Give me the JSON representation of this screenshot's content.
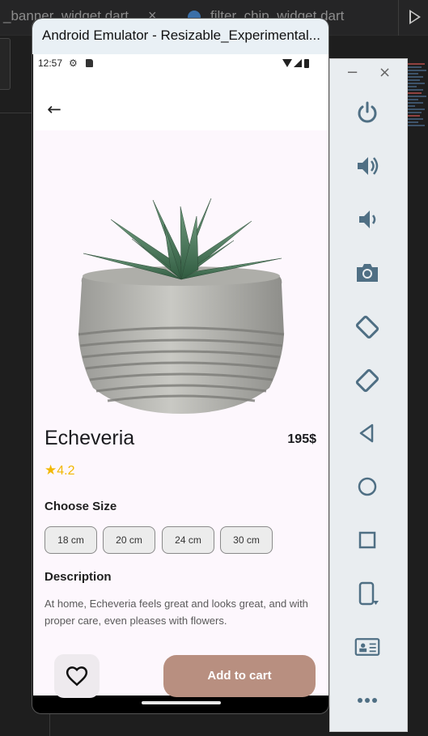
{
  "ide": {
    "tab1": "_banner_widget.dart",
    "tab1_close": "×",
    "tab2": "filter_chip_widget.dart"
  },
  "emulator": {
    "title": "Android Emulator - Resizable_Experimental..."
  },
  "status_bar": {
    "time": "12:57"
  },
  "product": {
    "name": "Echeveria",
    "price": "195$",
    "rating": "4.2",
    "choose_size_label": "Choose Size",
    "sizes": [
      "18 cm",
      "20 cm",
      "24 cm",
      "30 cm"
    ],
    "description_label": "Description",
    "description": "At home, Echeveria feels great and looks great, and with proper care, even pleases with flowers.",
    "add_to_cart": "Add to cart"
  },
  "side_panel": {
    "minimize": "−",
    "close": "×",
    "icons": [
      "power-icon",
      "volume-up-icon",
      "volume-down-icon",
      "camera-icon",
      "rotate-left-icon",
      "rotate-right-icon",
      "back-icon",
      "home-icon",
      "overview-icon",
      "fold-icon",
      "snapshot-icon",
      "more-icon"
    ]
  },
  "colors": {
    "accent": "#b88f80",
    "star": "#f2b800",
    "screen_bg": "#fdf7fd"
  }
}
